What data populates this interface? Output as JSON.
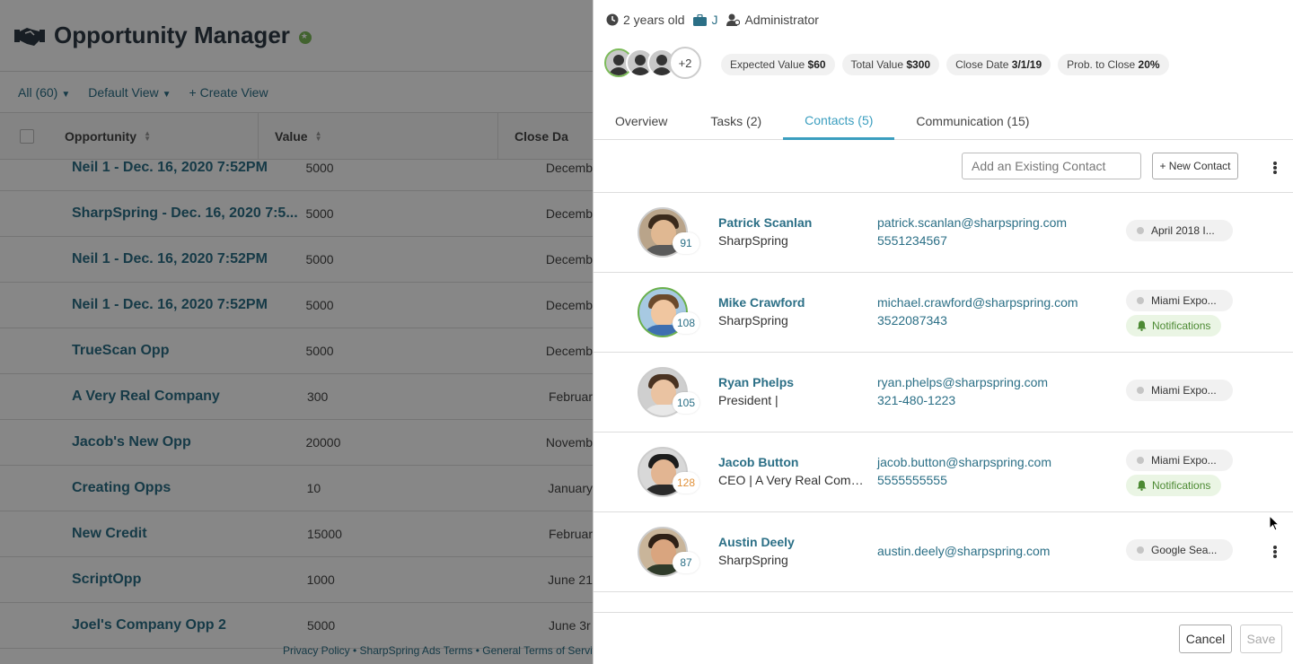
{
  "app": {
    "title": "Opportunity Manager",
    "view_all": "All (60)",
    "default_view": "Default View",
    "create_view": "+ Create View",
    "columns": {
      "opportunity": "Opportunity",
      "value": "Value",
      "close_date": "Close Da"
    },
    "rows": [
      {
        "name": "Neil 1 - Dec. 16, 2020 7:52PM",
        "value": "5000",
        "date": "Decemb"
      },
      {
        "name": "SharpSpring - Dec. 16, 2020 7:5...",
        "value": "5000",
        "date": "Decemb"
      },
      {
        "name": "Neil 1 - Dec. 16, 2020 7:52PM",
        "value": "5000",
        "date": "Decemb"
      },
      {
        "name": "Neil 1 - Dec. 16, 2020 7:52PM",
        "value": "5000",
        "date": "Decemb"
      },
      {
        "name": "TrueScan Opp",
        "value": "5000",
        "date": "Decemb"
      },
      {
        "name": "A Very Real Company",
        "value": "300",
        "date": "Februar"
      },
      {
        "name": "Jacob's New Opp",
        "value": "20000",
        "date": "Novemb"
      },
      {
        "name": "Creating Opps",
        "value": "10",
        "date": "January"
      },
      {
        "name": "New Credit",
        "value": "15000",
        "date": "Februar"
      },
      {
        "name": "ScriptOpp",
        "value": "1000",
        "date": "June 21"
      },
      {
        "name": "Joel's Company Opp 2",
        "value": "5000",
        "date": "June 3r"
      }
    ],
    "footer": "Privacy Policy • SharpSpring Ads Terms • General Terms of Service"
  },
  "drawer": {
    "age": "2 years old",
    "owner": "J",
    "role": "Administrator",
    "avatars_more": "+2",
    "pills": {
      "expected_label": "Expected Value ",
      "expected_value": "$60",
      "total_label": "Total Value ",
      "total_value": "$300",
      "close_label": "Close Date ",
      "close_value": "3/1/19",
      "prob_label": "Prob. to Close ",
      "prob_value": "20%"
    },
    "tabs": [
      "Overview",
      "Tasks (2)",
      "Contacts (5)",
      "Communication (15)"
    ],
    "add_contact_placeholder": "Add an Existing Contact",
    "new_contact": "+ New Contact",
    "contacts": [
      {
        "name": "Patrick Scanlan",
        "sub": "SharpSpring",
        "email": "patrick.scanlan@sharpspring.com",
        "phone": "5551234567",
        "score": "91",
        "tag": "April 2018 I...",
        "notif": ""
      },
      {
        "name": "Mike Crawford",
        "sub": "SharpSpring",
        "email": "michael.crawford@sharpspring.com",
        "phone": "3522087343",
        "score": "108",
        "tag": "Miami Expo...",
        "notif": "Notifications"
      },
      {
        "name": "Ryan Phelps",
        "sub": "President |",
        "email": "ryan.phelps@sharpspring.com",
        "phone": "321-480-1223",
        "score": "105",
        "tag": "Miami Expo...",
        "notif": ""
      },
      {
        "name": "Jacob Button",
        "sub": "CEO | A Very Real Comp...",
        "email": "jacob.button@sharpspring.com",
        "phone": "5555555555",
        "score": "128",
        "tag": "Miami Expo...",
        "notif": "Notifications"
      },
      {
        "name": "Austin Deely",
        "sub": "SharpSpring",
        "email": "austin.deely@sharpspring.com",
        "phone": "",
        "score": "87",
        "tag": "Google Sea...",
        "notif": ""
      }
    ],
    "cancel": "Cancel",
    "save": "Save"
  },
  "colors": {
    "accent": "#3b9ebf",
    "link": "#2b6f86",
    "green": "#6ab04c",
    "score_orange": "#e0913a"
  }
}
